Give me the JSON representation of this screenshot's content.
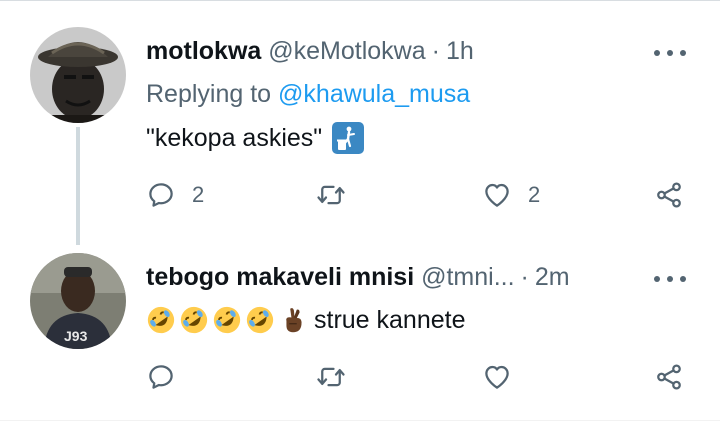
{
  "tweets": [
    {
      "display_name": "motlokwa",
      "handle": "@keMotlokwa",
      "separator": "·",
      "time": "1h",
      "replying_prefix": "Replying to",
      "replying_to": "@khawula_musa",
      "text": "\"kekopa askies\"",
      "text_icons": [
        "litter-in-bin-icon"
      ],
      "actions": {
        "reply_count": "2",
        "retweet_count": "",
        "like_count": "2"
      }
    },
    {
      "display_name": "tebogo makaveli mnisi",
      "handle": "@tmni...",
      "separator": "·",
      "time": "2m",
      "text": "strue kannete",
      "text_icons": [
        "rolling-on-floor-laughing-icon",
        "rolling-on-floor-laughing-icon",
        "rolling-on-floor-laughing-icon",
        "rolling-on-floor-laughing-icon",
        "crossed-fingers-icon"
      ],
      "actions": {
        "reply_count": "",
        "retweet_count": "",
        "like_count": ""
      }
    }
  ],
  "colors": {
    "link": "#1d9bf0",
    "secondary_text": "#536471",
    "primary_text": "#0f1419",
    "thread_line": "#cfd9de"
  }
}
